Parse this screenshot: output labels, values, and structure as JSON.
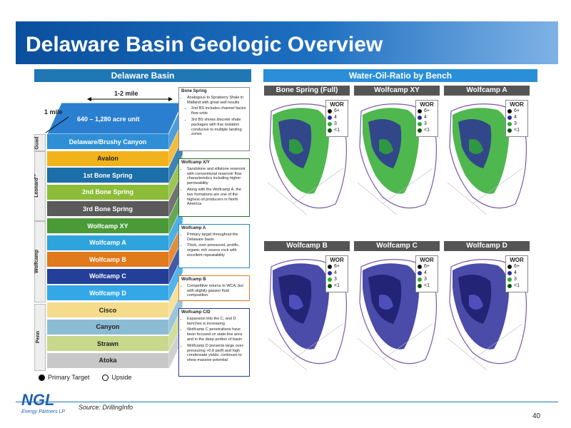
{
  "title": "Delaware Basin Geologic Overview",
  "left_header": "Delaware Basin",
  "right_header": "Water-Oil-Ratio by Bench",
  "block": {
    "width_label": "1-2 mile",
    "depth_label": "1 mile",
    "top_label": "640 – 1,280 acre unit"
  },
  "groups": {
    "guad": "Guad",
    "leonard": "Leonard'''",
    "wolfcamp": "Wolfcamp",
    "penn": "Penn"
  },
  "layers": [
    {
      "label": "Delaware/Brushy Canyon",
      "color": "#2e8fd6"
    },
    {
      "label": "Avalon",
      "color": "#f2b21c"
    },
    {
      "label": "1st Bone Spring",
      "color": "#1c6fa8"
    },
    {
      "label": "2nd Bone Spring",
      "color": "#8cbc38"
    },
    {
      "label": "3rd Bone Spring",
      "color": "#5a5a5a"
    },
    {
      "label": "Wolfcamp XY",
      "color": "#4a9a38"
    },
    {
      "label": "Wolfcamp A",
      "color": "#2fa3dc"
    },
    {
      "label": "Wolfcamp B",
      "color": "#e07a1a"
    },
    {
      "label": "Wolfcamp C",
      "color": "#233f98"
    },
    {
      "label": "Wolfcamp D",
      "color": "#34a8e6"
    },
    {
      "label": "Cisco",
      "color": "#f4dc8c"
    },
    {
      "label": "Canyon",
      "color": "#8cbcd4"
    },
    {
      "label": "Strawn",
      "color": "#c8d88c"
    },
    {
      "label": "Atoka",
      "color": "#c8c8c8"
    }
  ],
  "legend": {
    "primary": "Primary Target",
    "upside": "Upside"
  },
  "descriptions": {
    "bone_spring": {
      "title": "Bone Spring",
      "bullets": [
        "Analogous to Spraberry Shale in Midland with great well results",
        "2nd BS includes channel facies flow units",
        "3rd BS shows discrete shale packages with frac isolation conducive to multiple landing zones"
      ]
    },
    "wolfcamp_xy": {
      "title": "Wolfcamp X/Y",
      "bullets": [
        "Sandstone and siltstone reservoir with conventional reservoir flow characteristics including higher permeability",
        "Along with the Wolfcamp A, the two formations are one of the highest oil producers in North America"
      ]
    },
    "wolfcamp_a": {
      "title": "Wolfcamp A",
      "bullets": [
        "Primary target throughout the Delaware basin",
        "Thick, over-pressured, prolific, organic rich source rock with excellent repeatability"
      ]
    },
    "wolfcamp_b": {
      "title": "Wolfcamp B",
      "bullets": [
        "Competitive returns to WCA, but with slightly gassier fluid composition"
      ]
    },
    "wolfcamp_cd": {
      "title": "Wolfcamp C/D",
      "bullets": [
        "Expansion into the C, and D benches is increasing",
        "Wolfcamp C penetrations have been focused on state-line area and in the deep portion of basin",
        "Wolfcamp D presents large over-pressuring >0.8 psi/ft and high condensate yields; continues to show massive potential"
      ]
    }
  },
  "maps": [
    {
      "title": "Bone Spring (Full)"
    },
    {
      "title": "Wolfcamp XY"
    },
    {
      "title": "Wolfcamp A"
    },
    {
      "title": "Wolfcamp B"
    },
    {
      "title": "Wolfcamp C"
    },
    {
      "title": "Wolfcamp D"
    }
  ],
  "wor_legend": {
    "title": "WOR",
    "items": [
      {
        "label": "6+",
        "color": "#111111"
      },
      {
        "label": "4",
        "color": "#2b2b9a"
      },
      {
        "label": "3",
        "color": "#2faa2f"
      },
      {
        "label": "<1",
        "color": "#0b5a0b"
      }
    ]
  },
  "logo": {
    "mark": "NGL",
    "sub": "Energy Partners LP"
  },
  "source": "Source: DrillingInfo",
  "page_number": "40"
}
